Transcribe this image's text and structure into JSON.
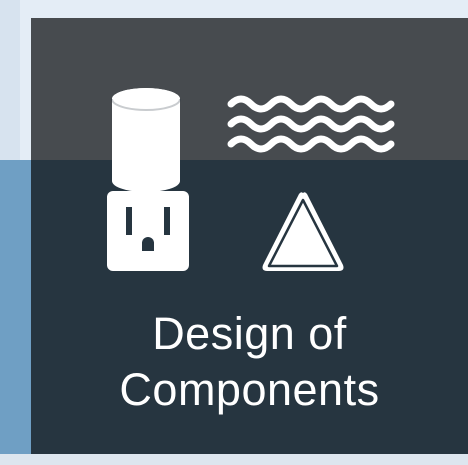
{
  "tile": {
    "title_line1": "Design of",
    "title_line2": "Components",
    "icons": [
      "cylinder-icon",
      "waves-icon",
      "power-outlet-icon",
      "warning-triangle-icon"
    ]
  },
  "colors": {
    "card": "#263540",
    "card_top": "#474b4f",
    "icon": "#ffffff",
    "text": "#ffffff",
    "background_top": "#e4edf6",
    "background_bottom": "#6f9fc4"
  }
}
